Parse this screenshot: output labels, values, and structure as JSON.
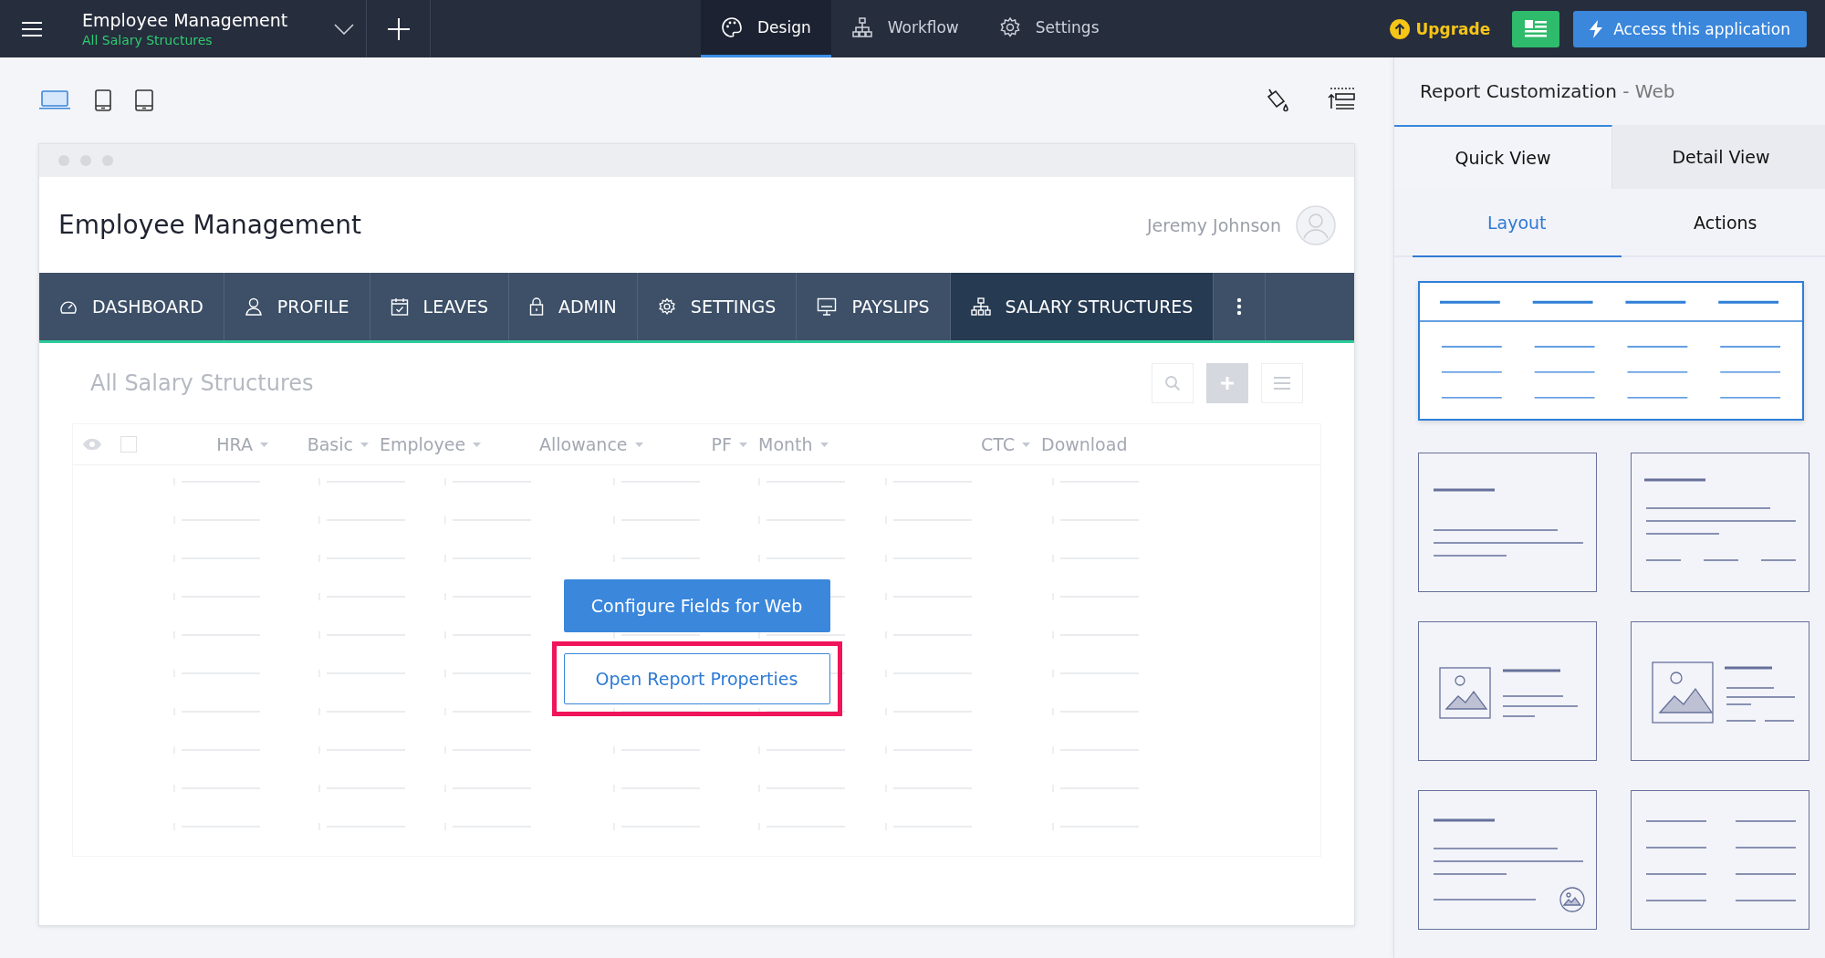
{
  "topbar": {
    "app_title": "Employee Management",
    "app_subtitle": "All Salary Structures",
    "tabs": [
      {
        "label": "Design",
        "kind": "design",
        "selected": true
      },
      {
        "label": "Workflow",
        "kind": "workflow",
        "selected": false
      },
      {
        "label": "Settings",
        "kind": "settings",
        "selected": false
      }
    ],
    "upgrade": "Upgrade",
    "access_button": "Access this application"
  },
  "device_tabs": [
    {
      "kind": "desktop",
      "selected": true
    },
    {
      "kind": "phone",
      "selected": false
    },
    {
      "kind": "tablet",
      "selected": false
    }
  ],
  "preview": {
    "app_title": "Employee Management",
    "user_name": "Jeremy Johnson",
    "nav": [
      {
        "label": "DASHBOARD",
        "kind": "dashboard",
        "selected": false
      },
      {
        "label": "PROFILE",
        "kind": "profile",
        "selected": false
      },
      {
        "label": "LEAVES",
        "kind": "leaves",
        "selected": false
      },
      {
        "label": "ADMIN",
        "kind": "admin",
        "selected": false
      },
      {
        "label": "SETTINGS",
        "kind": "settings",
        "selected": false
      },
      {
        "label": "PAYSLIPS",
        "kind": "payslips",
        "selected": false
      },
      {
        "label": "SALARY STRUCTURES",
        "kind": "structures",
        "selected": true
      }
    ],
    "report_title": "All Salary Structures",
    "select_all_checked": false,
    "columns": [
      {
        "label": "HRA",
        "sortable": true
      },
      {
        "label": "Basic",
        "sortable": true
      },
      {
        "label": "Employee",
        "sortable": true
      },
      {
        "label": "Allowance",
        "sortable": true
      },
      {
        "label": "PF",
        "sortable": true
      },
      {
        "label": "Month",
        "sortable": true
      },
      {
        "label": "CTC",
        "sortable": true
      },
      {
        "label": "Download",
        "sortable": false
      }
    ],
    "configure_button": "Configure Fields for Web",
    "properties_button": "Open Report Properties",
    "properties_highlighted": true
  },
  "panel": {
    "title": "Report Customization",
    "title_suffix": "- Web",
    "view_tabs": [
      {
        "label": "Quick View",
        "selected": true
      },
      {
        "label": "Detail View",
        "selected": false
      }
    ],
    "sub_tabs": [
      {
        "label": "Layout",
        "selected": true
      },
      {
        "label": "Actions",
        "selected": false
      }
    ],
    "layouts": [
      {
        "kind": "table",
        "selected": true
      },
      {
        "kind": "text",
        "selected": false
      },
      {
        "kind": "text-columns",
        "selected": false
      },
      {
        "kind": "image-left",
        "selected": false
      },
      {
        "kind": "image-card",
        "selected": false
      },
      {
        "kind": "text-image",
        "selected": false
      },
      {
        "kind": "two-column",
        "selected": false
      }
    ]
  }
}
